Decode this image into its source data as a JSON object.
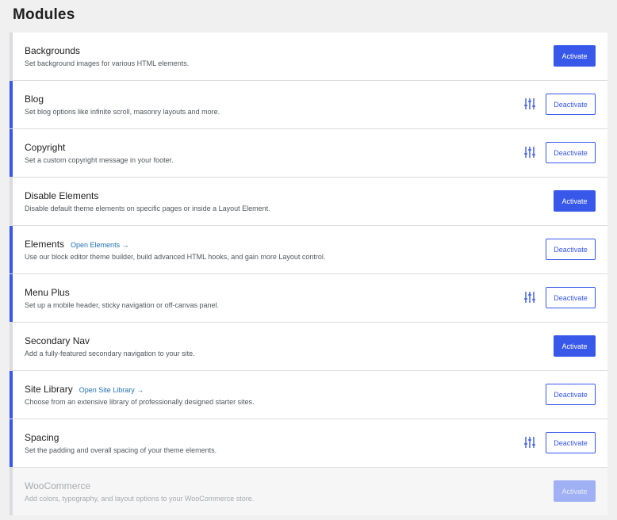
{
  "page": {
    "title": "Modules"
  },
  "colors": {
    "accent": "#3858e9",
    "border_inactive": "#dcdcde",
    "link": "#2271b1"
  },
  "modules": [
    {
      "name": "Backgrounds",
      "link": "",
      "desc": "Set background images for various HTML elements.",
      "button": "Activate",
      "state": "inactive",
      "settings": false
    },
    {
      "name": "Blog",
      "link": "",
      "desc": "Set blog options like infinite scroll, masonry layouts and more.",
      "button": "Deactivate",
      "state": "active",
      "settings": true
    },
    {
      "name": "Copyright",
      "link": "",
      "desc": "Set a custom copyright message in your footer.",
      "button": "Deactivate",
      "state": "active",
      "settings": true
    },
    {
      "name": "Disable Elements",
      "link": "",
      "desc": "Disable default theme elements on specific pages or inside a Layout Element.",
      "button": "Activate",
      "state": "inactive",
      "settings": false
    },
    {
      "name": "Elements",
      "link": "Open Elements →",
      "desc": "Use our block editor theme builder, build advanced HTML hooks, and gain more Layout control.",
      "button": "Deactivate",
      "state": "active",
      "settings": false
    },
    {
      "name": "Menu Plus",
      "link": "",
      "desc": "Set up a mobile header, sticky navigation or off-canvas panel.",
      "button": "Deactivate",
      "state": "active",
      "settings": true
    },
    {
      "name": "Secondary Nav",
      "link": "",
      "desc": "Add a fully-featured secondary navigation to your site.",
      "button": "Activate",
      "state": "inactive",
      "settings": false
    },
    {
      "name": "Site Library",
      "link": "Open Site Library →",
      "desc": "Choose from an extensive library of professionally designed starter sites.",
      "button": "Deactivate",
      "state": "active",
      "settings": false
    },
    {
      "name": "Spacing",
      "link": "",
      "desc": "Set the padding and overall spacing of your theme elements.",
      "button": "Deactivate",
      "state": "active",
      "settings": true
    },
    {
      "name": "WooCommerce",
      "link": "",
      "desc": "Add colors, typography, and layout options to your WooCommerce store.",
      "button": "Activate",
      "state": "disabled",
      "settings": false
    }
  ]
}
